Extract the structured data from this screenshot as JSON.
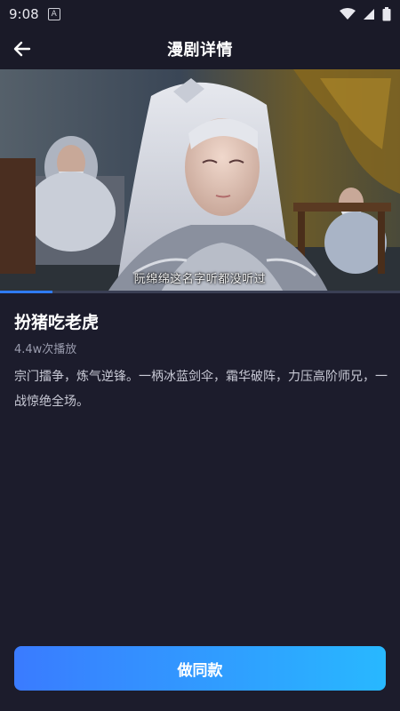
{
  "status_bar": {
    "time": "9:08",
    "notification_glyph": "A",
    "icons": [
      "wifi-icon",
      "signal-icon",
      "battery-icon"
    ]
  },
  "header": {
    "title": "漫剧详情",
    "back_icon": "arrow-left-icon"
  },
  "video": {
    "subtitle": "阮绵绵这名字听都没听过",
    "progress": 0.13,
    "accent_color": "#2f7bff"
  },
  "drama": {
    "title": "扮猪吃老虎",
    "play_count": "4.4w次播放",
    "description": "宗门擂争，炼气逆锋。一柄冰蓝剑伞，霜华破阵，力压高阶师兄，一战惊绝全场。"
  },
  "cta": {
    "label": "做同款",
    "gradient": [
      "#3a7bff",
      "#28b8ff"
    ]
  }
}
